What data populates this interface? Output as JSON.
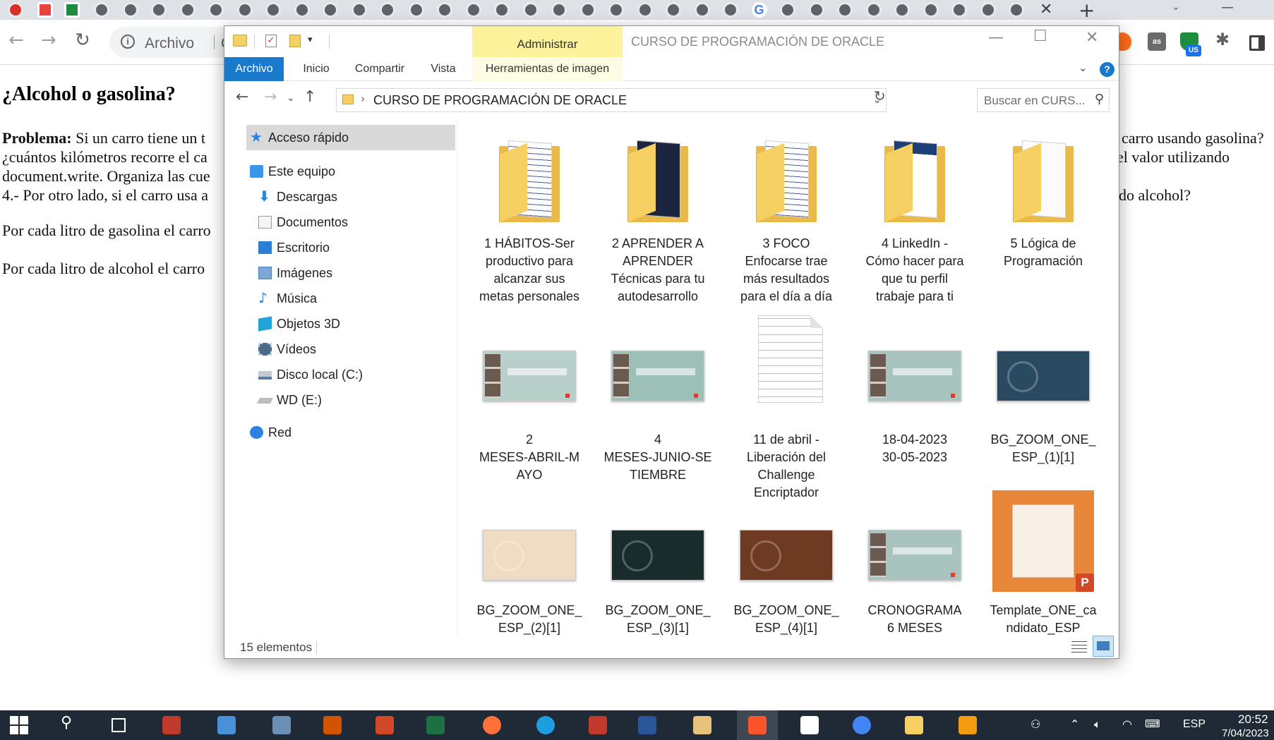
{
  "browser": {
    "address_scheme": "Archivo",
    "address_path": "C:",
    "tab_close_glyph": "✕",
    "new_tab_glyph": "+"
  },
  "webpage": {
    "heading": "¿Alcohol o gasolina?",
    "problem_bold": "Problema:",
    "line1_left": "Si un carro tiene un t",
    "line1_right": "carro usando gasolina?",
    "line2_left": "¿cuántos kilómetros recorre el ca",
    "line2_right": "el valor utilizando",
    "line3_left": "document.write. Organiza las cue",
    "line4_left": "4.- Por otro lado, si el carro usa a",
    "line4_right": "do alcohol?",
    "para2": "Por cada litro de gasolina el carro",
    "para3": "Por cada litro de alcohol el carro"
  },
  "explorer": {
    "title": "CURSO DE PROGRAMACIÓN DE ORACLE",
    "contextual_tab_group": "Administrar",
    "ribbon_tabs": [
      "Archivo",
      "Inicio",
      "Compartir",
      "Vista",
      "Herramientas de imagen"
    ],
    "help_glyph": "?",
    "address": "CURSO DE PROGRAMACIÓN DE ORACLE",
    "search_placeholder": "Buscar en CURS...",
    "nav": [
      {
        "label": "Acceso rápido",
        "icon": "star-icon"
      },
      {
        "label": "Este equipo",
        "icon": "computer-icon"
      },
      {
        "label": "Descargas",
        "icon": "downloads-icon"
      },
      {
        "label": "Documentos",
        "icon": "documents-icon"
      },
      {
        "label": "Escritorio",
        "icon": "desktop-icon"
      },
      {
        "label": "Imágenes",
        "icon": "pictures-icon"
      },
      {
        "label": "Música",
        "icon": "music-icon"
      },
      {
        "label": "Objetos 3D",
        "icon": "3d-objects-icon"
      },
      {
        "label": "Vídeos",
        "icon": "videos-icon"
      },
      {
        "label": "Disco local (C:)",
        "icon": "local-disk-icon"
      },
      {
        "label": "WD (E:)",
        "icon": "external-drive-icon"
      },
      {
        "label": "Red",
        "icon": "network-icon"
      }
    ],
    "items": [
      {
        "name": "1 HÁBITOS-Ser productivo para alcanzar sus metas personales",
        "lines": [
          "1 HÁBITOS-Ser",
          "productivo para",
          "alcanzar sus",
          "metas personales"
        ],
        "kind": "folder"
      },
      {
        "name": "2 APRENDER A APRENDER Técnicas para tu autodesarrollo",
        "lines": [
          "2 APRENDER A",
          "APRENDER",
          "Técnicas para tu",
          "autodesarrollo"
        ],
        "kind": "folder"
      },
      {
        "name": "3 FOCO Enfocarse trae más resultados para el día a día",
        "lines": [
          "3 FOCO",
          "Enfocarse trae",
          "más resultados",
          "para el día a día"
        ],
        "kind": "folder"
      },
      {
        "name": "4 LinkedIn - Cómo hacer para que tu perfil trabaje para ti",
        "lines": [
          "4 LinkedIn -",
          "Cómo hacer para",
          "que tu perfil",
          "trabaje para ti"
        ],
        "kind": "folder"
      },
      {
        "name": "5 Lógica de Programación",
        "lines": [
          "5 Lógica de",
          "Programación"
        ],
        "kind": "folder"
      },
      {
        "name": "2 MESES-ABRIL-MAYO",
        "lines": [
          "2",
          "MESES-ABRIL-M",
          "AYO"
        ],
        "kind": "video"
      },
      {
        "name": "4 MESES-JUNIO-SETIEMBRE",
        "lines": [
          "4",
          "MESES-JUNIO-SE",
          "TIEMBRE"
        ],
        "kind": "video"
      },
      {
        "name": "11 de abril - Liberación del Challenge Encriptador",
        "lines": [
          "11 de abril -",
          "Liberación del",
          "Challenge",
          "Encriptador"
        ],
        "kind": "document"
      },
      {
        "name": "18-04-2023 30-05-2023",
        "lines": [
          "18-04-2023",
          "30-05-2023"
        ],
        "kind": "video"
      },
      {
        "name": "BG_ZOOM_ONE_ESP_(1)[1]",
        "lines": [
          "BG_ZOOM_ONE_",
          "ESP_(1)[1]"
        ],
        "kind": "image"
      },
      {
        "name": "BG_ZOOM_ONE_ESP_(2)[1]",
        "lines": [
          "BG_ZOOM_ONE_",
          "ESP_(2)[1]"
        ],
        "kind": "image"
      },
      {
        "name": "BG_ZOOM_ONE_ESP_(3)[1]",
        "lines": [
          "BG_ZOOM_ONE_",
          "ESP_(3)[1]"
        ],
        "kind": "image"
      },
      {
        "name": "BG_ZOOM_ONE_ESP_(4)[1]",
        "lines": [
          "BG_ZOOM_ONE_",
          "ESP_(4)[1]"
        ],
        "kind": "image"
      },
      {
        "name": "CRONOGRAMA 6 MESES",
        "lines": [
          "CRONOGRAMA",
          "6 MESES"
        ],
        "kind": "video"
      },
      {
        "name": "Template_ONE_candidato_ESP",
        "lines": [
          "Template_ONE_ca",
          "ndidato_ESP"
        ],
        "kind": "presentation"
      }
    ],
    "status": "15 elementos"
  },
  "taskbar": {
    "language": "ESP",
    "time": "20:52",
    "date": "7/04/2023"
  },
  "colors": {
    "ribbon_file_tab": "#1979ca",
    "contextual_tab": "#fbf29b",
    "taskbar": "#1f2a36",
    "nav_selected": "#d9d9d9"
  }
}
